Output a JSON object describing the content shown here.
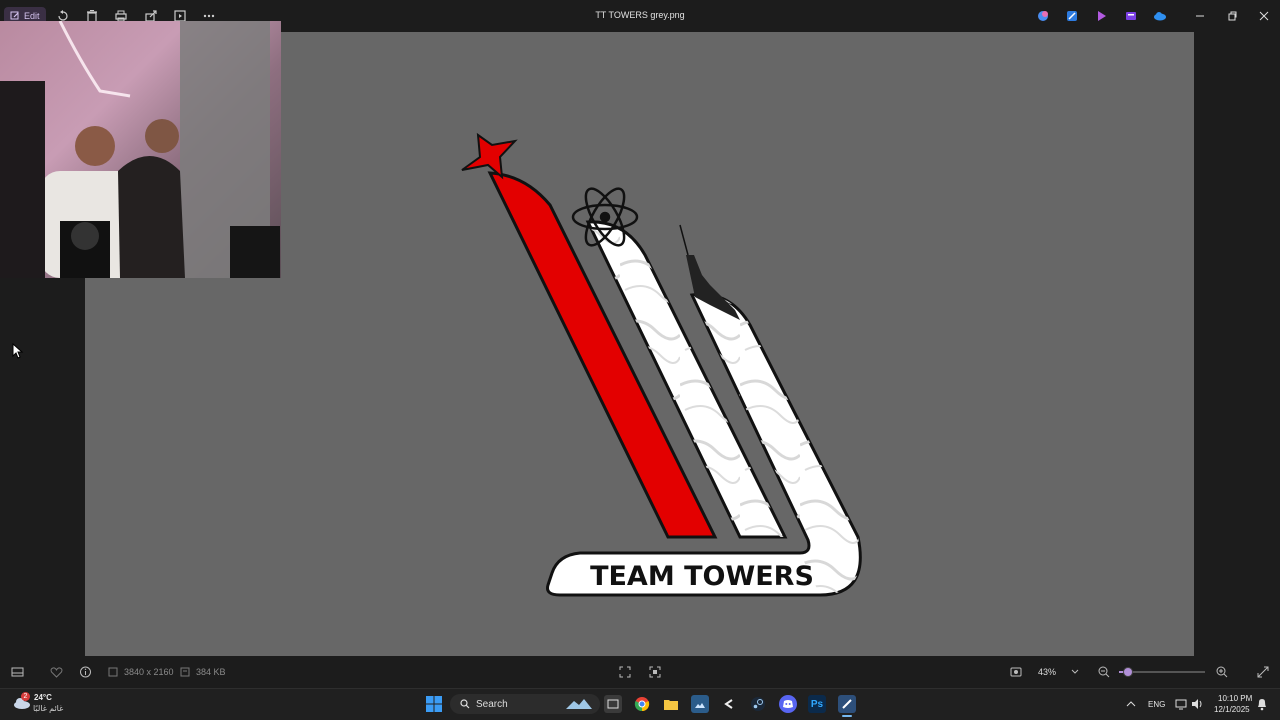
{
  "window": {
    "title": "TT TOWERS grey.png",
    "edit_label": "Edit"
  },
  "toolbar": {
    "icons": [
      "rotate-icon",
      "delete-icon",
      "print-icon",
      "share-icon",
      "slideshow-icon",
      "more-icon"
    ]
  },
  "image": {
    "logo_text": "TEAM TOWERS",
    "dimensions": "3840 x 2160",
    "file_size": "384 KB"
  },
  "zoom": {
    "level": "43%",
    "slider_fraction": 0.1
  },
  "taskbar": {
    "search_placeholder": "Search",
    "weather_temp": "24°C",
    "weather_desc": "غائم غالبًا",
    "weather_badge": "2",
    "language": "ENG",
    "time": "10:10 PM",
    "date": "12/1/2025"
  },
  "colors": {
    "canvas": "#676767",
    "logo_red": "#e30000",
    "accent": "#b18fd8"
  }
}
